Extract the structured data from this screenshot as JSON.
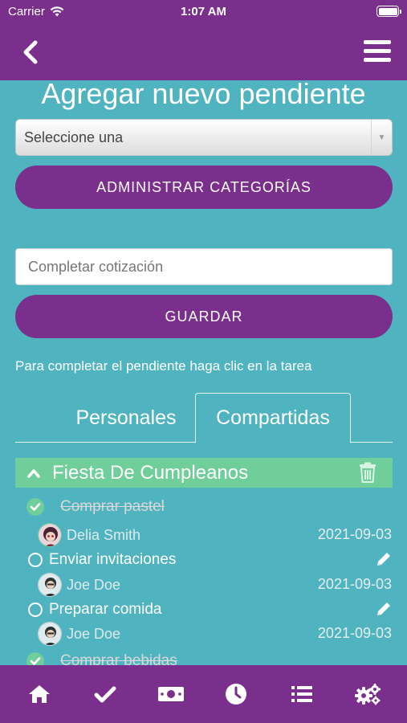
{
  "status_bar": {
    "carrier": "Carrier",
    "time": "1:07 AM"
  },
  "header": {
    "title": "Agregar nuevo pendiente"
  },
  "form": {
    "category_select": "Seleccione una",
    "manage_categories_label": "ADMINISTRAR CATEGORÍAS",
    "task_placeholder": "Completar cotización",
    "save_label": "GUARDAR",
    "hint": "Para completar el pendiente haga clic en la tarea"
  },
  "tabs": {
    "personales": "Personales",
    "compartidas": "Compartidas",
    "active": "Compartidas"
  },
  "group": {
    "name": "Fiesta De Cumpleanos",
    "tasks": [
      {
        "title": "Comprar pastel",
        "completed": true,
        "assignee": "Delia Smith",
        "date": "2021-09-03"
      },
      {
        "title": "Enviar invitaciones",
        "completed": false,
        "assignee": "Joe Doe",
        "date": "2021-09-03"
      },
      {
        "title": "Preparar comida",
        "completed": false,
        "assignee": "Joe Doe",
        "date": "2021-09-03"
      },
      {
        "title": "Comprar bebidas",
        "completed": true
      }
    ]
  },
  "bottom_nav": {
    "items": [
      "home-icon",
      "check-icon",
      "money-icon",
      "clock-icon",
      "list-icon",
      "settings-icon"
    ]
  },
  "colors": {
    "purple": "#7a2f8c",
    "teal": "#4fb3c0",
    "green": "#6fce9a"
  }
}
